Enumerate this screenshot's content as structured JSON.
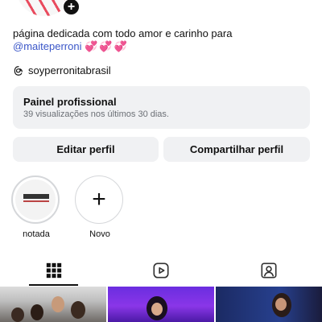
{
  "profile": {
    "bio_text": "página dedicada com todo amor e carinho para",
    "mention": "@maiteperroni",
    "hearts": "💞💞💞",
    "threads_handle": "soyperronitabrasil"
  },
  "dashboard": {
    "title": "Painel profissional",
    "subtitle": "39 visualizações nos últimos 30 dias."
  },
  "actions": {
    "edit_label": "Editar perfil",
    "share_label": "Compartilhar perfil"
  },
  "highlights": [
    {
      "label": "notada"
    },
    {
      "label": "Novo",
      "icon": "plus-icon"
    }
  ],
  "tabs": [
    {
      "icon": "grid-icon",
      "selected": true
    },
    {
      "icon": "reels-icon",
      "selected": false
    },
    {
      "icon": "tagged-icon",
      "selected": false
    }
  ],
  "colors": {
    "accent_link": "#3a56c8",
    "button_bg": "#f0f1f3",
    "hearts": "#d94fc7"
  }
}
